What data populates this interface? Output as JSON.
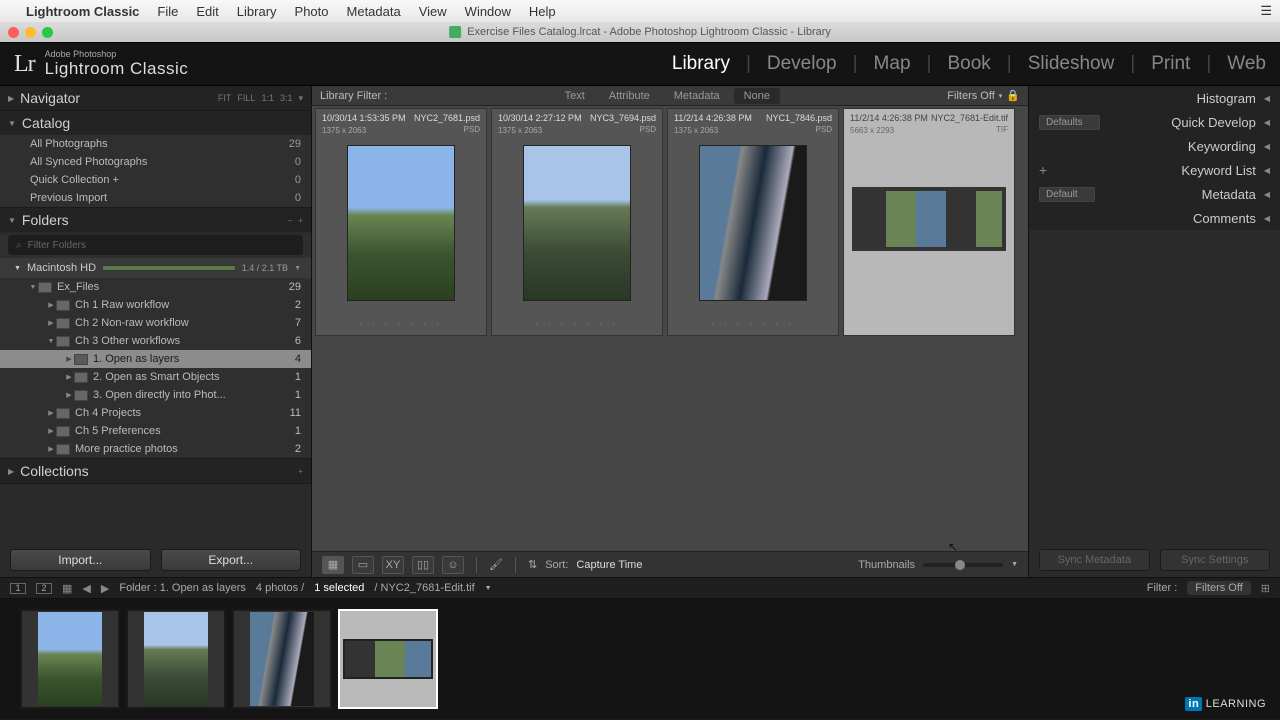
{
  "mac_menu": {
    "app": "Lightroom Classic",
    "items": [
      "File",
      "Edit",
      "Library",
      "Photo",
      "Metadata",
      "View",
      "Window",
      "Help"
    ]
  },
  "titlebar": {
    "text": "Exercise Files Catalog.lrcat - Adobe Photoshop Lightroom Classic - Library"
  },
  "identity": {
    "brand_small": "Adobe Photoshop",
    "brand": "Lightroom Classic"
  },
  "modules": [
    "Library",
    "Develop",
    "Map",
    "Book",
    "Slideshow",
    "Print",
    "Web"
  ],
  "active_module": "Library",
  "filter_bar": {
    "label": "Library Filter :",
    "tabs": [
      "Text",
      "Attribute",
      "Metadata",
      "None"
    ],
    "active_tab": "None",
    "filters_off": "Filters Off"
  },
  "left": {
    "navigator": {
      "title": "Navigator",
      "modes": [
        "FIT",
        "FILL",
        "1:1",
        "3:1"
      ]
    },
    "catalog": {
      "title": "Catalog",
      "rows": [
        {
          "label": "All Photographs",
          "count": "29"
        },
        {
          "label": "All Synced Photographs",
          "count": "0"
        },
        {
          "label": "Quick Collection  +",
          "count": "0"
        },
        {
          "label": "Previous Import",
          "count": "0"
        }
      ]
    },
    "folders": {
      "title": "Folders",
      "filter_placeholder": "Filter Folders",
      "volume": {
        "name": "Macintosh HD",
        "size": "1.4 / 2.1 TB"
      },
      "tree": [
        {
          "depth": 0,
          "expanded": true,
          "label": "Ex_Files",
          "count": "29"
        },
        {
          "depth": 1,
          "expanded": false,
          "label": "Ch 1 Raw workflow",
          "count": "2"
        },
        {
          "depth": 1,
          "expanded": false,
          "label": "Ch 2 Non-raw workflow",
          "count": "7"
        },
        {
          "depth": 1,
          "expanded": true,
          "label": "Ch 3 Other workflows",
          "count": "6"
        },
        {
          "depth": 2,
          "expanded": false,
          "label": "1. Open as layers",
          "count": "4",
          "selected": true
        },
        {
          "depth": 2,
          "expanded": false,
          "label": "2. Open as Smart Objects",
          "count": "1"
        },
        {
          "depth": 2,
          "expanded": false,
          "label": "3. Open directly into Phot...",
          "count": "1"
        },
        {
          "depth": 1,
          "expanded": false,
          "label": "Ch 4 Projects",
          "count": "11"
        },
        {
          "depth": 1,
          "expanded": false,
          "label": "Ch 5 Preferences",
          "count": "1"
        },
        {
          "depth": 1,
          "expanded": false,
          "label": "More practice photos",
          "count": "2"
        }
      ]
    },
    "collections": {
      "title": "Collections"
    },
    "buttons": {
      "import": "Import...",
      "export": "Export..."
    }
  },
  "right": {
    "histogram": "Histogram",
    "quick_develop": {
      "title": "Quick Develop",
      "dropdown": "Defaults"
    },
    "keywording": "Keywording",
    "keyword_list": "Keyword List",
    "metadata": {
      "title": "Metadata",
      "dropdown": "Default"
    },
    "comments": "Comments",
    "sync_metadata": "Sync Metadata",
    "sync_settings": "Sync Settings"
  },
  "thumbs": [
    {
      "date": "10/30/14 1:53:35 PM",
      "file": "NYC2_7681.psd",
      "dims": "1375 x 2063",
      "fmt": "PSD",
      "photo": "a"
    },
    {
      "date": "10/30/14 2:27:12 PM",
      "file": "NYC3_7694.psd",
      "dims": "1375 x 2063",
      "fmt": "PSD",
      "photo": "b"
    },
    {
      "date": "11/2/14 4:26:38 PM",
      "file": "NYC1_7846.psd",
      "dims": "1375 x 2063",
      "fmt": "PSD",
      "photo": "c"
    },
    {
      "date": "11/2/14 4:26:38 PM",
      "file": "NYC2_7681-Edit.tif",
      "dims": "5663 x 2293",
      "fmt": "TIF",
      "photo": "d",
      "selected": true,
      "wide": true
    }
  ],
  "toolbar": {
    "sort_label": "Sort:",
    "sort_value": "Capture Time",
    "thumbnails": "Thumbnails"
  },
  "filmstrip_bar": {
    "monitors": [
      "1",
      "2"
    ],
    "path": "Folder : 1. Open as layers",
    "count": "4 photos /",
    "selected": "1 selected",
    "file": "/ NYC2_7681-Edit.tif",
    "filter_label": "Filter :",
    "filter_value": "Filters Off"
  },
  "footer_brand": "Linked in LEARNING"
}
